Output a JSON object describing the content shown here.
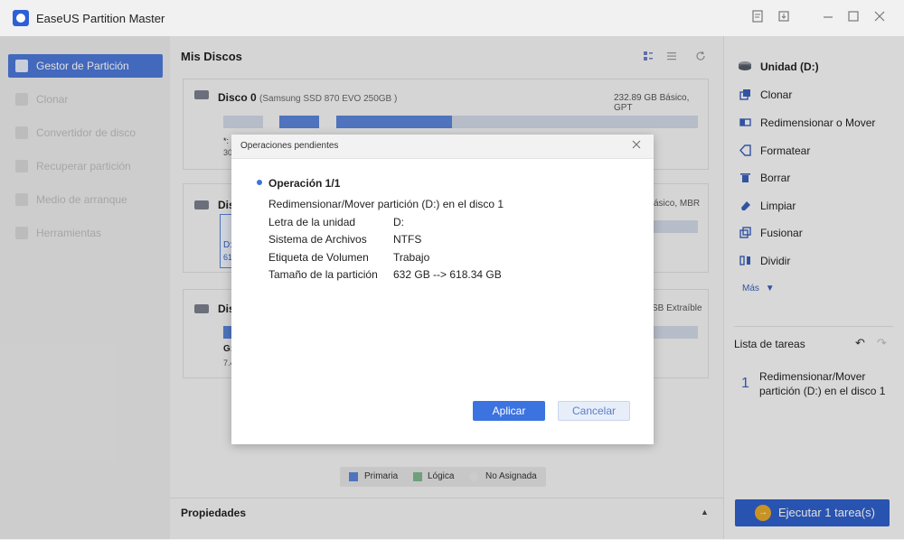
{
  "titlebar": {
    "app_title": "EaseUS Partition Master",
    "icons": [
      "notes-icon",
      "download-icon",
      "minimize-icon",
      "maximize-icon",
      "close-icon"
    ]
  },
  "sidebar": {
    "items": [
      {
        "label": "Gestor de Partición",
        "active": true
      },
      {
        "label": "Clonar",
        "active": false
      },
      {
        "label": "Convertidor de disco",
        "active": false
      },
      {
        "label": "Recuperar partición",
        "active": false
      },
      {
        "label": "Medio de arranque",
        "active": false
      },
      {
        "label": "Herramientas",
        "active": false
      }
    ]
  },
  "main": {
    "title": "Mis Discos",
    "disks": [
      {
        "name": "Disco 0",
        "model": "(Samsung SSD 870 EVO 250GB )",
        "info": "232.89 GB Básico, GPT",
        "fragment_a": "*:",
        "fragment_b": "30"
      },
      {
        "name": "Dis",
        "info": "ásico, MBR",
        "fragment_a": "D:",
        "fragment_b": "61"
      },
      {
        "name": "Dis",
        "info": "SB Extraíble",
        "fragment_a": "G:",
        "fragment_b": "7.4"
      }
    ],
    "legend": {
      "primary": "Primaria",
      "logical": "Lógica",
      "unallocated": "No Asignada"
    },
    "properties_label": "Propiedades"
  },
  "right_panel": {
    "unit_title": "Unidad (D:)",
    "actions": [
      "Clonar",
      "Redimensionar o Mover",
      "Formatear",
      "Borrar",
      "Limpiar",
      "Fusionar",
      "Dividir"
    ],
    "more_label": "Más",
    "tasks_title": "Lista de tareas",
    "task": {
      "number": "1",
      "text": "Redimensionar/Mover partición (D:) en el disco 1"
    },
    "execute_label": "Ejecutar 1 tarea(s)"
  },
  "dialog": {
    "title": "Operaciones pendientes",
    "operation_title": "Operación 1/1",
    "operation_desc": "Redimensionar/Mover partición (D:) en el disco 1",
    "rows": [
      {
        "key": "Letra de la unidad",
        "value": "D:"
      },
      {
        "key": "Sistema de Archivos",
        "value": "NTFS"
      },
      {
        "key": "Etiqueta de Volumen",
        "value": "Trabajo"
      },
      {
        "key": "Tamaño de la partición",
        "value": "632 GB --> 618.34 GB"
      }
    ],
    "apply_label": "Aplicar",
    "cancel_label": "Cancelar"
  },
  "colors": {
    "accent": "#3b73e0",
    "primary_partition": "#5b83d6",
    "logical_partition": "#7fb78a",
    "unallocated": "#d0d6e4"
  }
}
